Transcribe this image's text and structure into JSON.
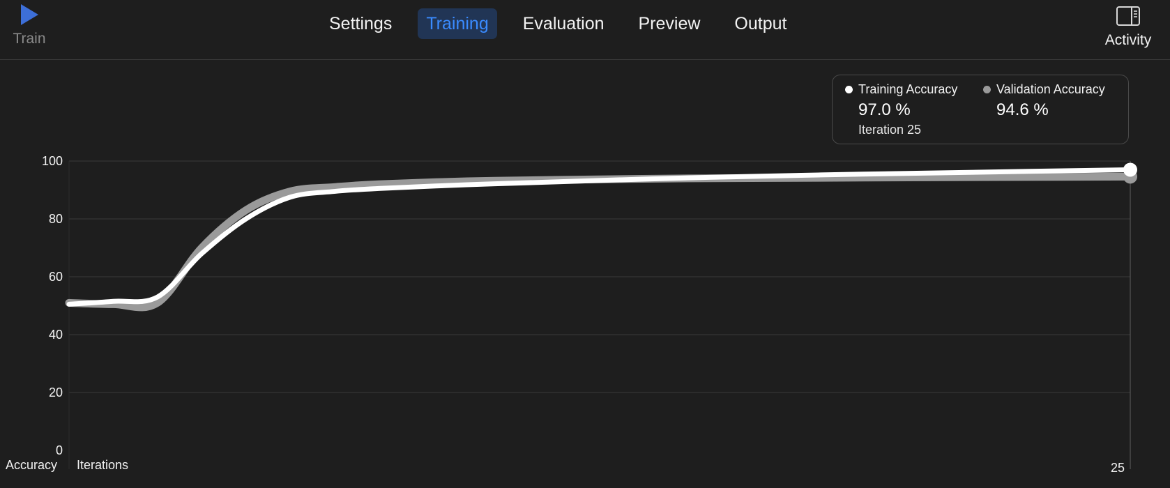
{
  "toolbar": {
    "train_label": "Train",
    "activity_label": "Activity",
    "tabs": [
      {
        "label": "Settings",
        "active": false
      },
      {
        "label": "Training",
        "active": true
      },
      {
        "label": "Evaluation",
        "active": false
      },
      {
        "label": "Preview",
        "active": false
      },
      {
        "label": "Output",
        "active": false
      }
    ]
  },
  "icons": {
    "train": "play-icon",
    "activity": "sidebar-icon"
  },
  "colors": {
    "accent": "#3a8bff",
    "play": "#3d6fd8",
    "training_series": "#ffffff",
    "validation_series": "#9a9a9a"
  },
  "legend": {
    "training": {
      "label": "Training Accuracy",
      "value": "97.0 %",
      "iteration": "Iteration 25"
    },
    "validation": {
      "label": "Validation Accuracy",
      "value": "94.6 %"
    }
  },
  "chart_data": {
    "type": "line",
    "ylabel": "Accuracy",
    "xlabel": "Iterations",
    "ylim": [
      0,
      100
    ],
    "xlim": [
      1,
      25
    ],
    "yticks": [
      0,
      20,
      40,
      60,
      80,
      100
    ],
    "xticks": [
      25
    ],
    "grid": true,
    "legend_position": "top-right",
    "series": [
      {
        "name": "Training Accuracy",
        "x": [
          1,
          2,
          3,
          4,
          5,
          6,
          7,
          8,
          10,
          12,
          15,
          18,
          21,
          25
        ],
        "y": [
          50.5,
          51.5,
          53,
          68,
          80,
          87.5,
          89.5,
          90.5,
          91.8,
          92.8,
          94.2,
          95.2,
          96,
          97.0
        ]
      },
      {
        "name": "Validation Accuracy",
        "x": [
          1,
          2,
          3,
          4,
          5,
          6,
          7,
          8,
          10,
          12,
          15,
          18,
          21,
          25
        ],
        "y": [
          51,
          50.5,
          51,
          70,
          83,
          89.5,
          91,
          92,
          93,
          93.5,
          94,
          94.2,
          94.4,
          94.6
        ]
      }
    ]
  }
}
